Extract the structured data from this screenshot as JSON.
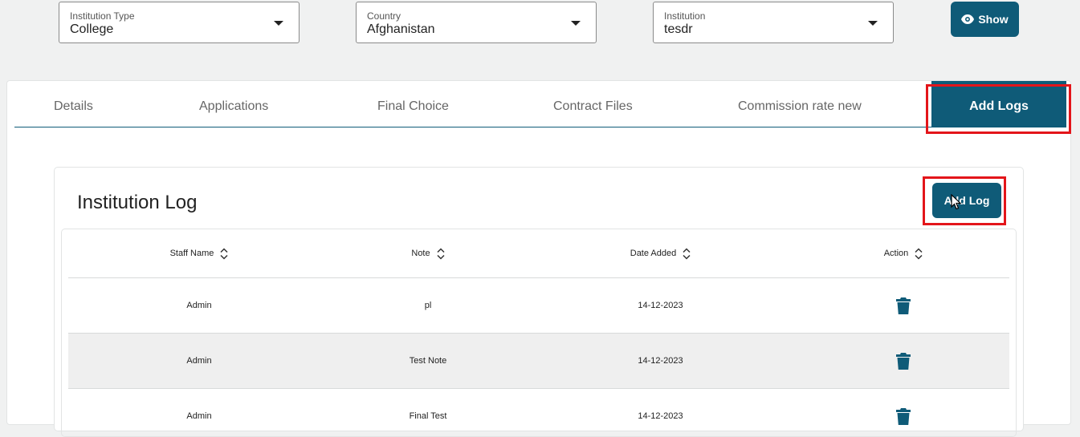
{
  "filters": {
    "institution_type": {
      "label": "Institution Type",
      "value": "College"
    },
    "country": {
      "label": "Country",
      "value": "Afghanistan"
    },
    "institution": {
      "label": "Institution",
      "value": "tesdr"
    },
    "show_label": "Show"
  },
  "tabs": [
    {
      "label": "Details"
    },
    {
      "label": "Applications"
    },
    {
      "label": "Final Choice"
    },
    {
      "label": "Contract Files"
    },
    {
      "label": "Commission rate new"
    },
    {
      "label": "Add Logs"
    }
  ],
  "log": {
    "title": "Institution Log",
    "add_button": "Add Log",
    "columns": [
      "Staff Name",
      "Note",
      "Date Added",
      "Action"
    ],
    "rows": [
      {
        "staff": "Admin",
        "note": "pl",
        "date": "14-12-2023"
      },
      {
        "staff": "Admin",
        "note": "Test Note",
        "date": "14-12-2023"
      },
      {
        "staff": "Admin",
        "note": "Final Test",
        "date": "14-12-2023"
      }
    ]
  },
  "colors": {
    "accent": "#0f5b78",
    "highlight": "#e3151a"
  },
  "icons": {
    "show": "eye-icon",
    "sort": "sort-icon",
    "delete": "trash-icon",
    "dropdown": "caret-down-icon"
  }
}
